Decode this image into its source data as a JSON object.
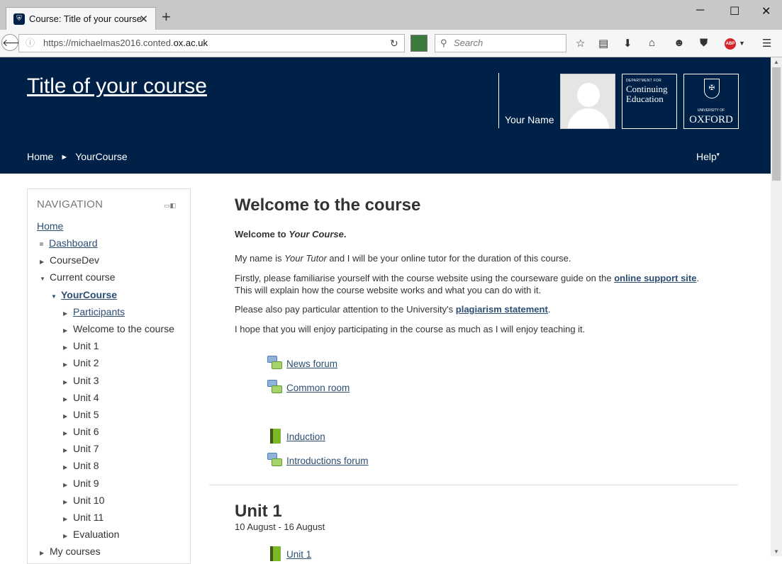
{
  "browser": {
    "tab_title": "Course: Title of your course",
    "url_prefix": "https://michaelmas2016.conted.",
    "url_host": "ox.ac.uk",
    "search_placeholder": "Search"
  },
  "header": {
    "course_title": "Title of your course",
    "user_name": "Your Name",
    "logo_conted_small": "DEPARTMENT FOR",
    "logo_conted_big": "Continuing Education",
    "logo_ox_small": "UNIVERSITY OF",
    "logo_ox_big": "OXFORD",
    "help": "Help",
    "breadcrumb": [
      "Home",
      "YourCourse"
    ]
  },
  "navigation": {
    "title": "NAVIGATION",
    "home": "Home",
    "dashboard": "Dashboard",
    "coursedev": "CourseDev",
    "current_course": "Current course",
    "your_course": "YourCourse",
    "participants": "Participants",
    "sections": [
      "Welcome to the course",
      "Unit 1",
      "Unit 2",
      "Unit 3",
      "Unit 4",
      "Unit 5",
      "Unit 6",
      "Unit 7",
      "Unit 8",
      "Unit 9",
      "Unit 10",
      "Unit 11",
      "Evaluation"
    ],
    "my_courses": "My courses"
  },
  "main": {
    "heading": "Welcome to the course",
    "p1_a": "Welcome to ",
    "p1_em": "Your Course",
    "p1_b": ".",
    "p2_a": "My name is ",
    "p2_em": "Your Tutor",
    "p2_b": " and I will be your online tutor for the duration of this course.",
    "p3_a": "Firstly, please familiarise yourself with the course website using the courseware guide on the ",
    "p3_link": "online support site",
    "p3_b": ". This will explain how the course website works and what you can do with it.",
    "p4_a": "Please also pay particular attention to the University's ",
    "p4_link": "plagiarism statement",
    "p4_b": ".",
    "p5": "I hope that you will enjoy participating in the course as much as I will enjoy teaching it.",
    "activities": [
      "News forum",
      "Common room",
      "Induction",
      "Introductions forum"
    ],
    "unit_heading": "Unit 1",
    "unit_dates": "10 August - 16 August",
    "unit_first_activity": "Unit 1"
  }
}
